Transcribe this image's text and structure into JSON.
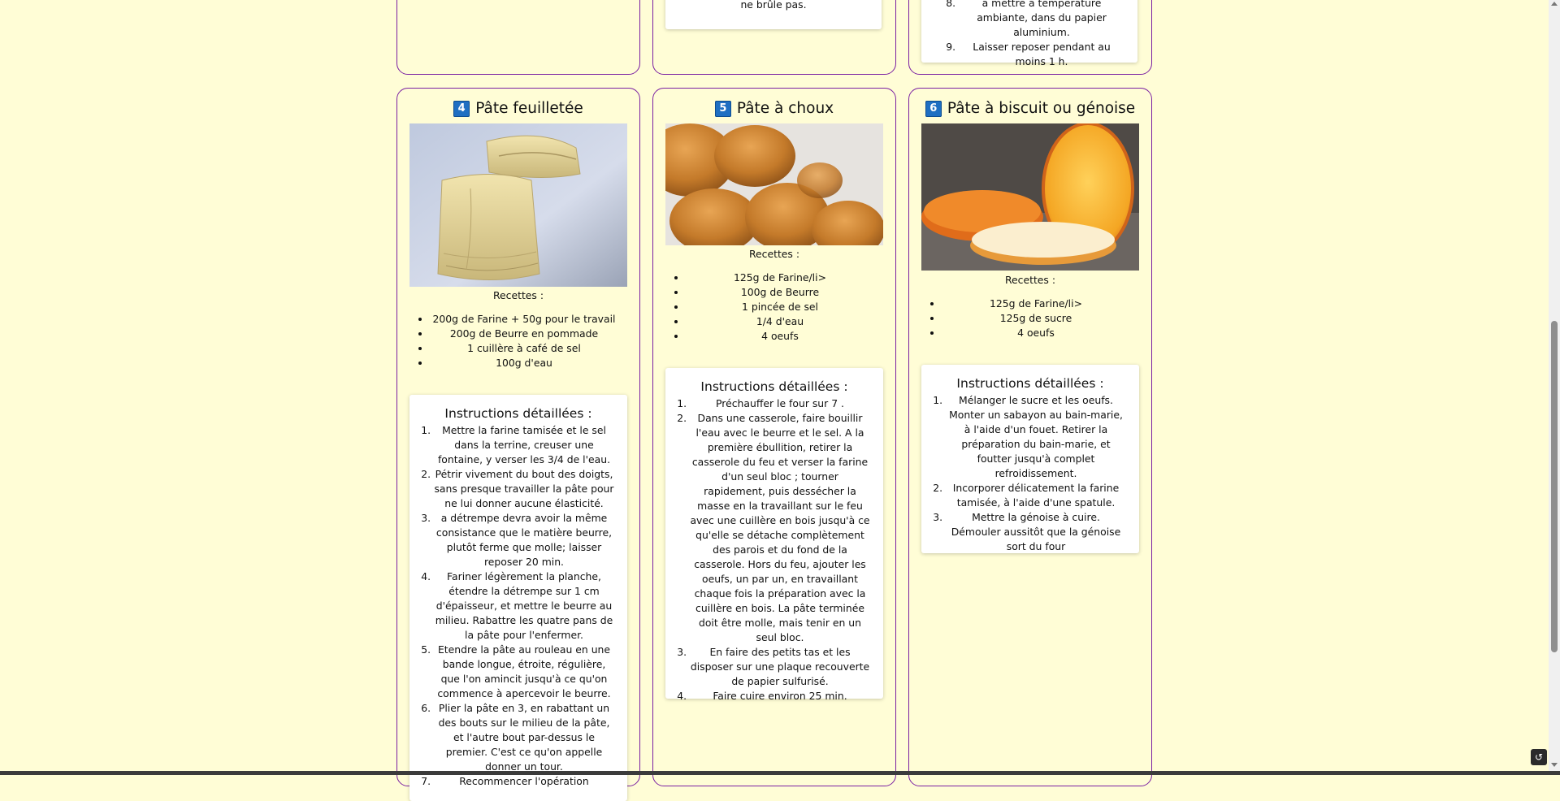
{
  "top_row": {
    "col2_text": "ne brûle pas.",
    "col3_step8": "à mettre à température ambiante, dans du papier aluminium.",
    "col3_step9": "Laisser reposer pendant au moins 1 h."
  },
  "cards": [
    {
      "number": "4",
      "title": "Pâte feuilletée",
      "recipes_label": "Recettes :",
      "ingredients": [
        "200g de Farine + 50g pour le travail",
        "200g de Beurre en pommade",
        "1 cuillère à café de sel",
        "100g d'eau"
      ],
      "instructions_title": "Instructions détaillées :",
      "steps": [
        "Mettre la farine tamisée et le sel dans la terrine, creuser une fontaine, y verser les 3/4 de l'eau.",
        "Pétrir vivement du bout des doigts, sans presque travailler la pâte pour ne lui donner aucune élasticité.",
        "a détrempe devra avoir la même consistance que le matière beurre, plutôt ferme que molle; laisser reposer 20 min.",
        "Fariner légèrement la planche, étendre la détrempe sur 1 cm d'épaisseur, et mettre le beurre au milieu. Rabattre les quatre pans de la pâte pour l'enfermer.",
        "Etendre la pâte au rouleau en une bande longue, étroite, régulière, que l'on amincit jusqu'à ce qu'on commence à apercevoir le beurre.",
        "Plier la pâte en 3, en rabattant un des bouts sur le milieu de la pâte, et l'autre bout par-dessus le premier. C'est ce qu'on appelle donner un tour.",
        "Recommencer l'opération"
      ]
    },
    {
      "number": "5",
      "title": "Pâte à choux",
      "recipes_label": "Recettes :",
      "ingredients": [
        "125g de Farine/li>",
        "100g de Beurre",
        "1 pincée de sel",
        "1/4 d'eau",
        "4 oeufs"
      ],
      "instructions_title": "Instructions détaillées :",
      "steps": [
        "Préchauffer le four sur 7 .",
        "Dans une casserole, faire bouillir l'eau avec le beurre et le sel. A la première ébullition, retirer la casserole du feu et verser la farine d'un seul bloc ; tourner rapidement, puis dessécher la masse en la travaillant sur le feu avec une cuillère en bois jusqu'à ce qu'elle se détache complètement des parois et du fond de la casserole. Hors du feu, ajouter les oeufs, un par un, en travaillant chaque fois la préparation avec la cuillère en bois. La pâte terminée doit être molle, mais tenir en un seul bloc.",
        "En faire des petits tas et les disposer sur une plaque recouverte de papier sulfurisé.",
        "Faire cuire environ 25 min."
      ]
    },
    {
      "number": "6",
      "title": "Pâte à biscuit ou génoise",
      "recipes_label": "Recettes :",
      "ingredients": [
        "125g de Farine/li>",
        "125g de sucre",
        "4 oeufs"
      ],
      "instructions_title": "Instructions détaillées :",
      "steps": [
        "Mélanger le sucre et les oeufs. Monter un sabayon au bain-marie, à l'aide d'un fouet. Retirer la préparation du bain-marie, et foutter jusqu'à complet refroidissement.",
        "Incorporer délicatement la farine tamisée, à l'aide d'une spatule.",
        "Mettre la génoise à cuire. Démouler aussitôt que la génoise sort du four"
      ]
    }
  ]
}
